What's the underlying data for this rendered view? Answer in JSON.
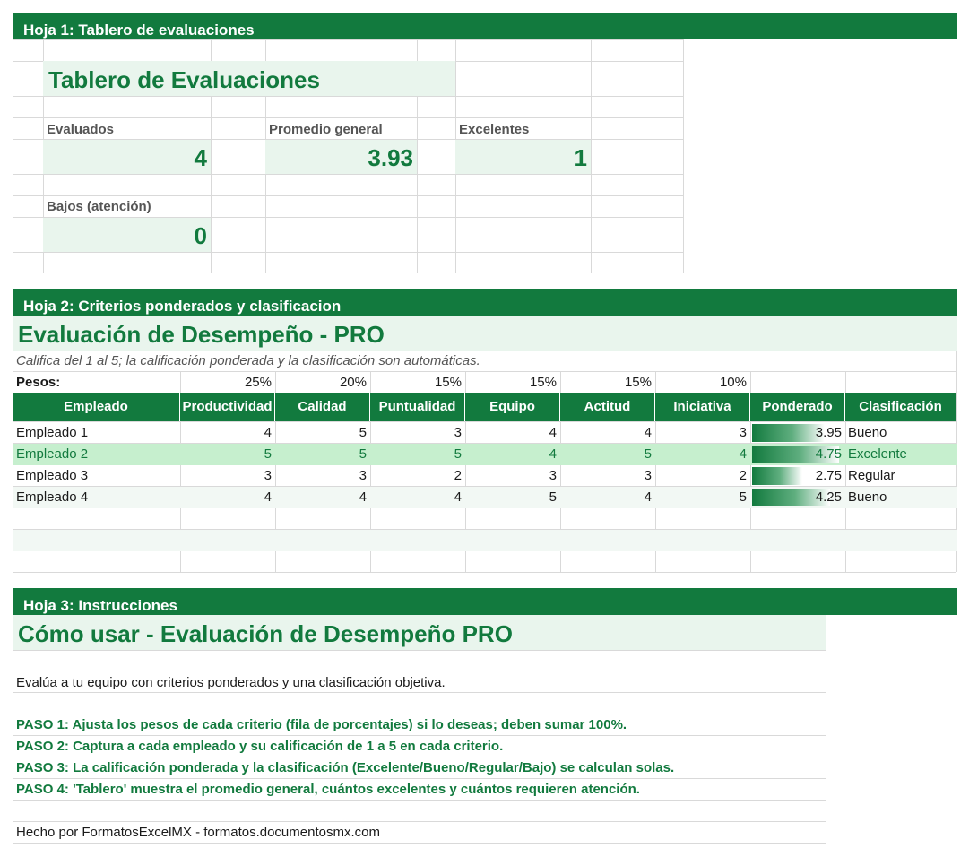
{
  "sheet1": {
    "band": "Hoja 1: Tablero de evaluaciones",
    "title": "Tablero de Evaluaciones",
    "kpis": [
      {
        "label": "Evaluados",
        "value": "4"
      },
      {
        "label": "Promedio general",
        "value": "3.93"
      },
      {
        "label": "Excelentes",
        "value": "1"
      },
      {
        "label": "Bajos (atención)",
        "value": "0"
      }
    ]
  },
  "sheet2": {
    "band": "Hoja 2: Criterios ponderados y clasificacion",
    "title": "Evaluación de Desempeño - PRO",
    "subtitle": "Califica del 1 al 5; la calificación ponderada y la clasificación son automáticas.",
    "weights_label": "Pesos:",
    "weights": [
      "25%",
      "20%",
      "15%",
      "15%",
      "15%",
      "10%"
    ],
    "headers": [
      "Empleado",
      "Productividad",
      "Calidad",
      "Puntualidad",
      "Equipo",
      "Actitud",
      "Iniciativa",
      "Ponderado",
      "Clasificación"
    ],
    "rows": [
      {
        "name": "Empleado 1",
        "scores": [
          "4",
          "5",
          "3",
          "4",
          "4",
          "3"
        ],
        "weighted": "3.95",
        "weighted_pct": 0.79,
        "class": "Bueno"
      },
      {
        "name": "Empleado 2",
        "scores": [
          "5",
          "5",
          "5",
          "4",
          "5",
          "4"
        ],
        "weighted": "4.75",
        "weighted_pct": 0.95,
        "class": "Excelente"
      },
      {
        "name": "Empleado 3",
        "scores": [
          "3",
          "3",
          "2",
          "3",
          "3",
          "2"
        ],
        "weighted": "2.75",
        "weighted_pct": 0.55,
        "class": "Regular"
      },
      {
        "name": "Empleado 4",
        "scores": [
          "4",
          "4",
          "4",
          "5",
          "4",
          "5"
        ],
        "weighted": "4.25",
        "weighted_pct": 0.85,
        "class": "Bueno"
      }
    ]
  },
  "sheet3": {
    "band": "Hoja 3: Instrucciones",
    "title": "Cómo usar - Evaluación de Desempeño PRO",
    "intro": "Evalúa a tu equipo con criterios ponderados y una clasificación objetiva.",
    "steps": [
      "PASO 1: Ajusta los pesos de cada criterio (fila de porcentajes) si lo deseas; deben sumar 100%.",
      "PASO 2: Captura a cada empleado y su calificación de 1 a 5 en cada criterio.",
      "PASO 3: La calificación ponderada y la clasificación (Excelente/Bueno/Regular/Bajo) se calculan solas.",
      "PASO 4: 'Tablero' muestra el promedio general, cuántos excelentes y cuántos requieren atención."
    ],
    "footer": "Hecho por FormatosExcelMX - formatos.documentosmx.com"
  },
  "colors": {
    "accent": "#127a3e",
    "tint": "#e9f5ed",
    "highlight": "#c6efce"
  }
}
